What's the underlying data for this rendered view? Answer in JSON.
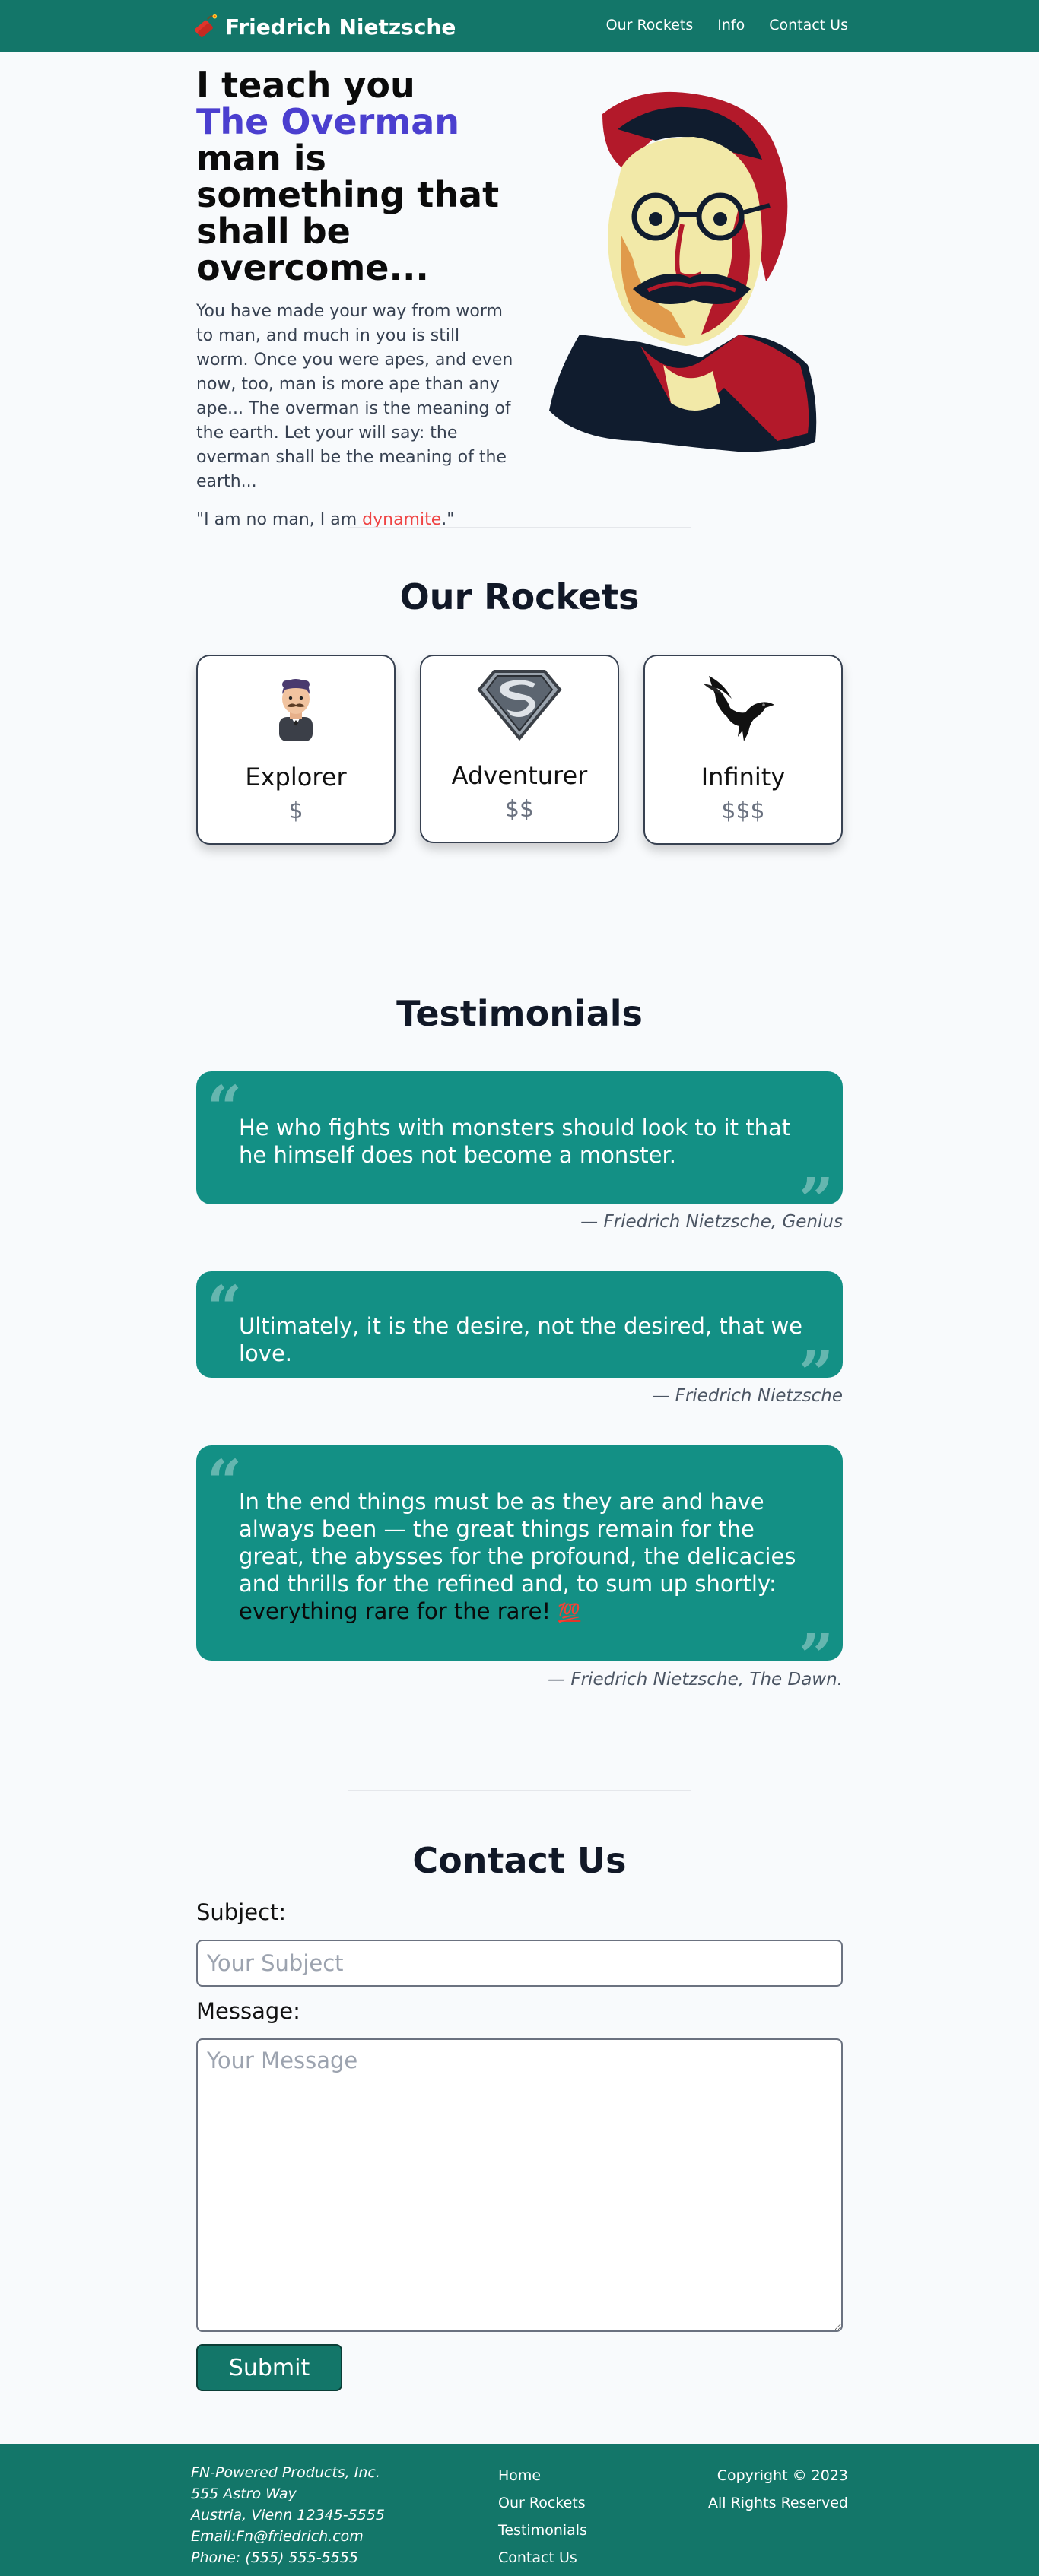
{
  "header": {
    "brand": "Friedrich Nietzsche",
    "nav": [
      "Our Rockets",
      "Info",
      "Contact Us"
    ]
  },
  "hero": {
    "title_line1": "I teach you",
    "title_accent": "The Overman",
    "title_rest": "man is something that shall be overcome...",
    "paragraph": "You have made your way from worm to man, and much in you is still worm. Once you were apes, and even now, too, man is more ape than any ape... The overman is the meaning of the earth. Let your will say: the overman shall be the meaning of the earth...",
    "quote_pre": "\"I am no man, I am ",
    "quote_dyn": "dynamite",
    "quote_post": ".\""
  },
  "rockets": {
    "title": "Our Rockets",
    "items": [
      {
        "name": "Explorer",
        "price": "$"
      },
      {
        "name": "Adventurer",
        "price": "$$"
      },
      {
        "name": "Infinity",
        "price": "$$$"
      }
    ]
  },
  "testimonials": {
    "title": "Testimonials",
    "items": [
      {
        "text": "He who fights with monsters should look to it that he himself does not become a monster.",
        "author": "— Friedrich Nietzsche, Genius"
      },
      {
        "text": "Ultimately, it is the desire, not the desired, that we love.",
        "author": "— Friedrich Nietzsche"
      },
      {
        "text": "In the end things must be as they are and have always been — the great things remain for the great, the abysses for the profound, the delicacies and thrills for the refined and, to sum up shortly: ",
        "highlight": "everything rare for the rare!",
        "author": "— Friedrich Nietzsche, The Dawn."
      }
    ]
  },
  "contact": {
    "title": "Contact Us",
    "subject_label": "Subject:",
    "subject_placeholder": "Your Subject",
    "message_label": "Message:",
    "message_placeholder": "Your Message",
    "submit_label": "Submit"
  },
  "footer": {
    "address": [
      "FN-Powered Products, Inc.",
      "555 Astro Way",
      "Austria, Vienn 12345-5555",
      "Email:Fn@friedrich.com",
      "Phone: (555) 555-5555"
    ],
    "links": [
      "Home",
      "Our Rockets",
      "Testimonials",
      "Contact Us"
    ],
    "copyright": "Copyright © 2023",
    "rights": "All Rights Reserved"
  }
}
